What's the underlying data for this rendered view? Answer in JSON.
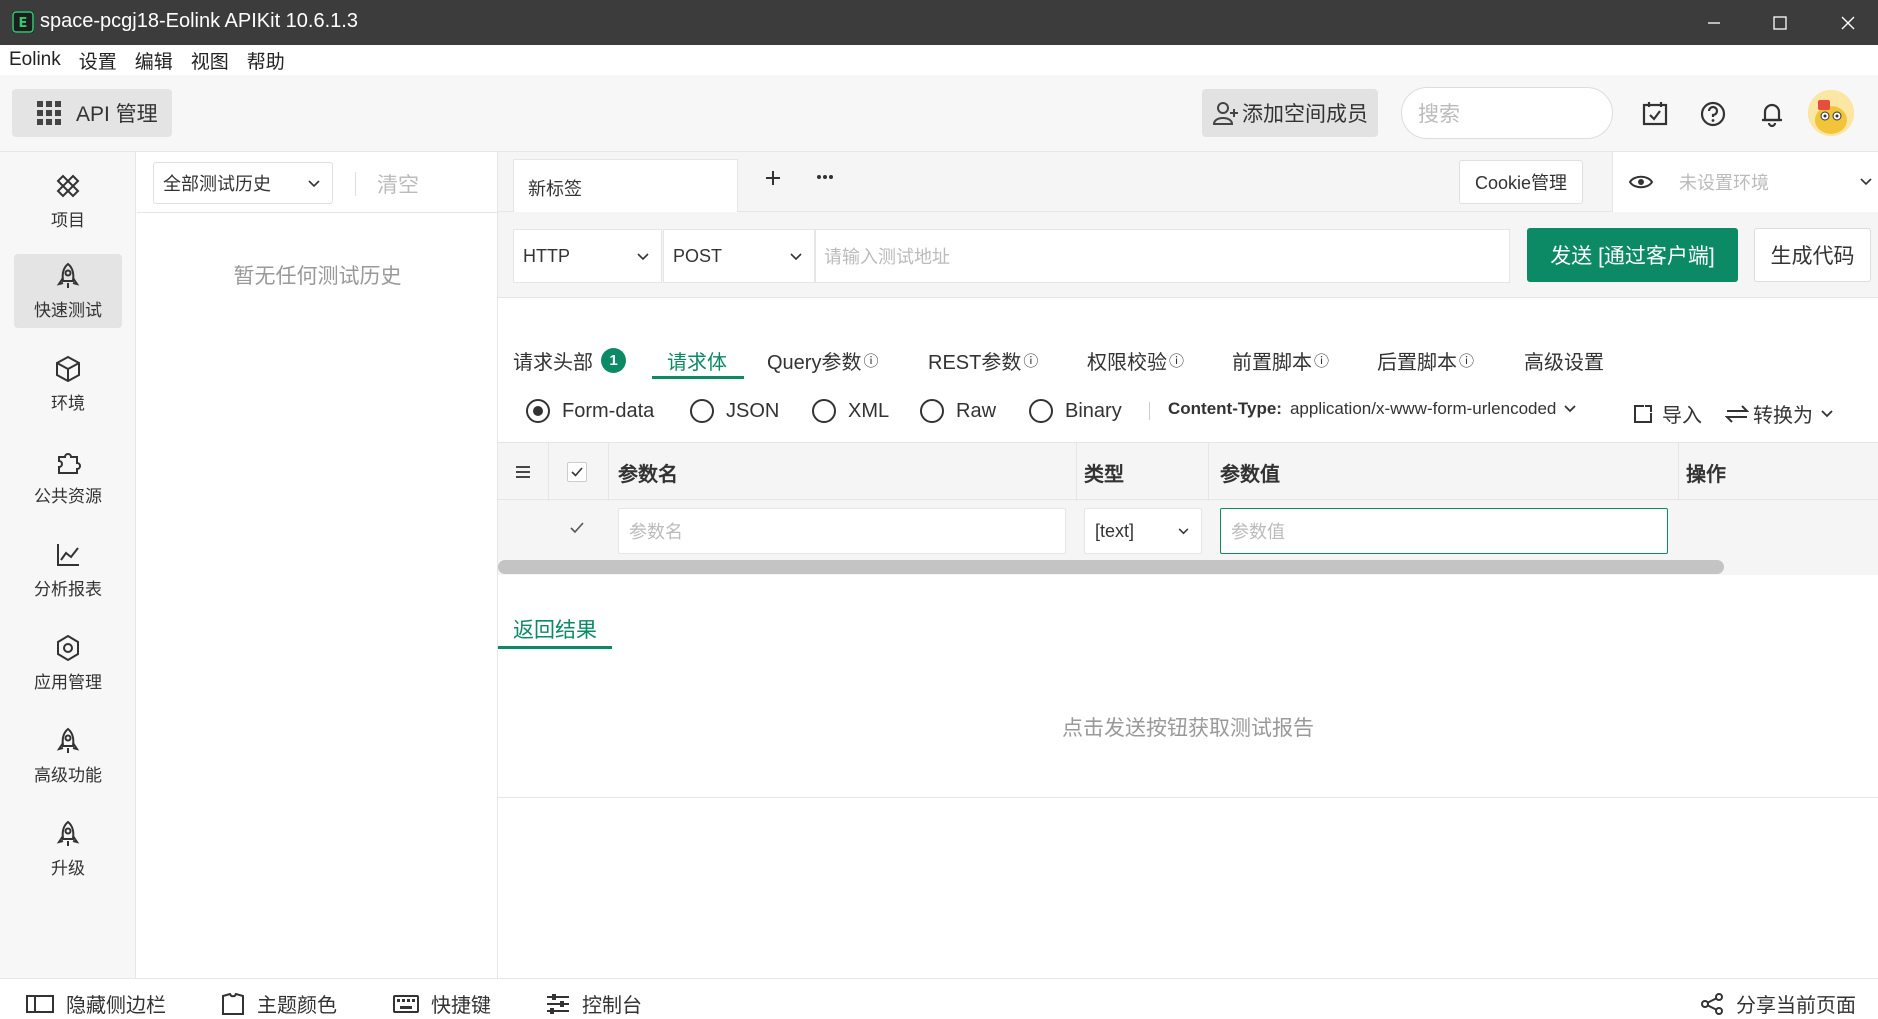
{
  "window": {
    "title": "space-pcgj18-Eolink APIKit 10.6.1.3",
    "minimize_icon": "minimize-icon",
    "maximize_icon": "maximize-icon",
    "close_icon": "close-icon"
  },
  "menu": [
    "Eolink",
    "设置",
    "编辑",
    "视图",
    "帮助"
  ],
  "header": {
    "module_label": "API 管理",
    "add_member_label": "添加空间成员",
    "search_placeholder": "搜索",
    "icons": [
      "calendar-check-icon",
      "help-icon",
      "bell-icon",
      "avatar"
    ]
  },
  "sidebar": {
    "items": [
      {
        "label": "项目",
        "icon": "project-icon"
      },
      {
        "label": "快速测试",
        "icon": "rocket-icon",
        "active": true
      },
      {
        "label": "环境",
        "icon": "cube-icon"
      },
      {
        "label": "公共资源",
        "icon": "puzzle-icon"
      },
      {
        "label": "分析报表",
        "icon": "chart-icon"
      },
      {
        "label": "应用管理",
        "icon": "gear-icon"
      },
      {
        "label": "高级功能",
        "icon": "rocket-icon"
      },
      {
        "label": "升级",
        "icon": "rocket-icon"
      }
    ]
  },
  "history": {
    "filter_label": "全部测试历史",
    "clear_label": "清空",
    "empty_text": "暂无任何测试历史"
  },
  "tabs": {
    "current": "新标签",
    "cookie_label": "Cookie管理",
    "env_placeholder": "未设置环境"
  },
  "request": {
    "protocol": "HTTP",
    "method": "POST",
    "url_placeholder": "请输入测试地址",
    "send_label": "发送 [通过客户端]",
    "generate_label": "生成代码"
  },
  "request_tabs": [
    {
      "label": "请求头部",
      "badge": "1"
    },
    {
      "label": "请求体",
      "active": true
    },
    {
      "label": "Query参数",
      "info": "ⓘ"
    },
    {
      "label": "REST参数",
      "info": "ⓘ"
    },
    {
      "label": "权限校验",
      "info": "ⓘ"
    },
    {
      "label": "前置脚本",
      "info": "ⓘ"
    },
    {
      "label": "后置脚本",
      "info": "ⓘ"
    },
    {
      "label": "高级设置"
    }
  ],
  "body_types": {
    "options": [
      "Form-data",
      "JSON",
      "XML",
      "Raw",
      "Binary"
    ],
    "selected": "Form-data",
    "content_type_label": "Content-Type:",
    "content_type_value": "application/x-www-form-urlencoded",
    "import_label": "导入",
    "convert_label": "转换为"
  },
  "params_table": {
    "columns": [
      "参数名",
      "类型",
      "参数值",
      "操作"
    ],
    "row": {
      "name_placeholder": "参数名",
      "type_value": "[text]",
      "value_placeholder": "参数值"
    }
  },
  "result": {
    "tab_label": "返回结果",
    "empty_text": "点击发送按钮获取测试报告"
  },
  "footer": {
    "items": [
      {
        "label": "隐藏侧边栏",
        "icon": "sidebar-icon"
      },
      {
        "label": "主题颜色",
        "icon": "shirt-icon"
      },
      {
        "label": "快捷键",
        "icon": "keyboard-icon"
      },
      {
        "label": "控制台",
        "icon": "sliders-icon"
      }
    ],
    "share_label": "分享当前页面"
  },
  "colors": {
    "accent": "#0c8a66",
    "titlebar": "#3c3c3c"
  }
}
